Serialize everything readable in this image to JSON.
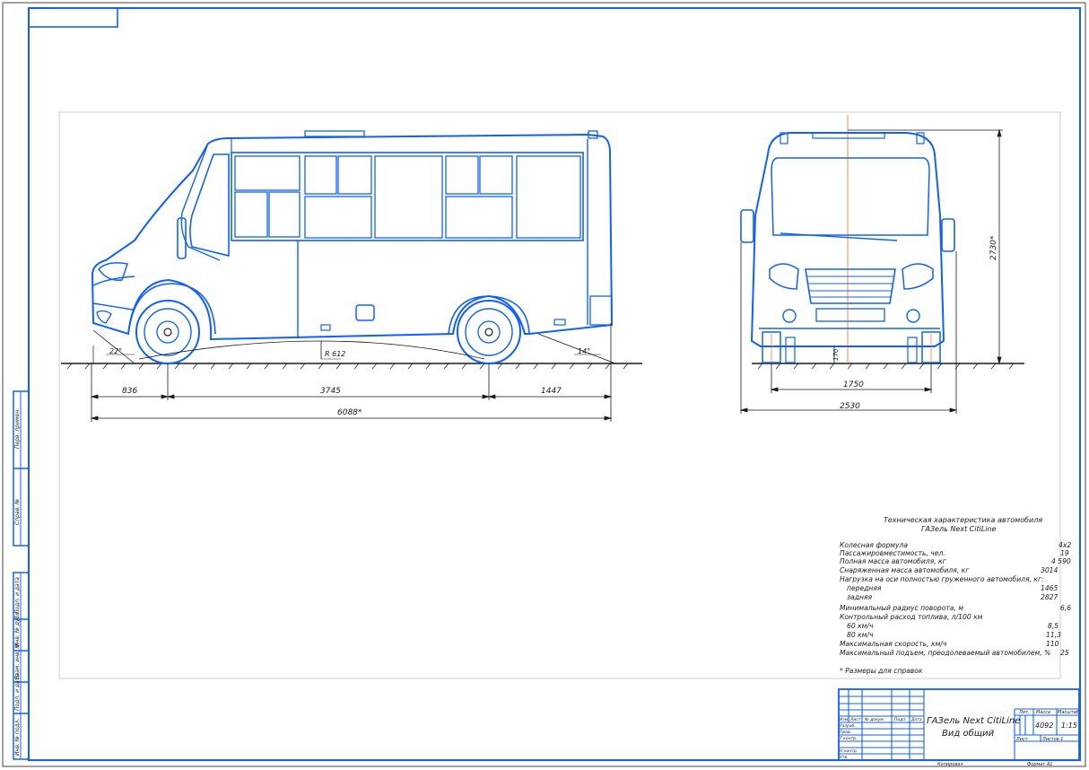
{
  "dimensions": {
    "front_overhang": "836",
    "wheelbase": "3745",
    "rear_overhang": "1447",
    "overall_length": "6088*",
    "ground_clearance": "R 612",
    "approach_angle": "22°",
    "departure_angle": "14°",
    "track_width": "1750",
    "overall_width": "2530",
    "overall_height": "2730*",
    "front_clearance": "170"
  },
  "spec": {
    "title_line1": "Техническая характеристика автомобиля",
    "title_line2": "ГАЗель Next CitiLine",
    "rows": [
      {
        "label": "Колесная формула",
        "value": "4x2"
      },
      {
        "label": "Пассажировместимость, чел.",
        "value": "19"
      },
      {
        "label": "Полная масса автомобиля, кг",
        "value": "4 590"
      },
      {
        "label": "Снаряженная масса автомобиля, кг",
        "value": "3014"
      },
      {
        "label": "Нагрузка на оси полностью груженного автомобиля, кг:",
        "value": ""
      },
      {
        "label": "передняя",
        "value": "1465"
      },
      {
        "label": "задняя",
        "value": "2827"
      },
      {
        "label": "Минимальный радиус поворота, м",
        "value": "6,6"
      },
      {
        "label": "Контрольный расход топлива, л/100 км",
        "value": ""
      },
      {
        "label": "60 км/ч",
        "value": "8,5"
      },
      {
        "label": "80 км/ч",
        "value": "11,3"
      },
      {
        "label": "Максимальная скорость, км/ч",
        "value": "110"
      },
      {
        "label": "Максимальный подъем, преодолеваемый автомобилем, %",
        "value": "25"
      }
    ],
    "footnote": "* Размеры для справок"
  },
  "title_block": {
    "name_line1": "ГАЗель Next CitiLine",
    "name_line2": "Вид общий",
    "mass": "4092",
    "scale": "1:15",
    "sheet": "Лист",
    "sheets": "Листов 1",
    "copied": "Копировал",
    "format": "Формат A1",
    "col_lit": "Лит.",
    "col_mass": "Масса",
    "col_scale": "Масштаб",
    "row_izm": "Изм. Лист",
    "row_doc": "№ докум.",
    "row_sign": "Подп.",
    "row_date": "Дата",
    "roles": [
      "Разраб.",
      "Пров.",
      "Т.контр.",
      "",
      "Н.контр.",
      "Утв."
    ]
  },
  "side_stamp": {
    "labels": [
      "Перв. примен.",
      "Справ. №",
      "Подп. и дата",
      "Инв. № дубл.",
      "Взам. инв. №",
      "Подп. и дата",
      "Инв. № подл."
    ]
  }
}
